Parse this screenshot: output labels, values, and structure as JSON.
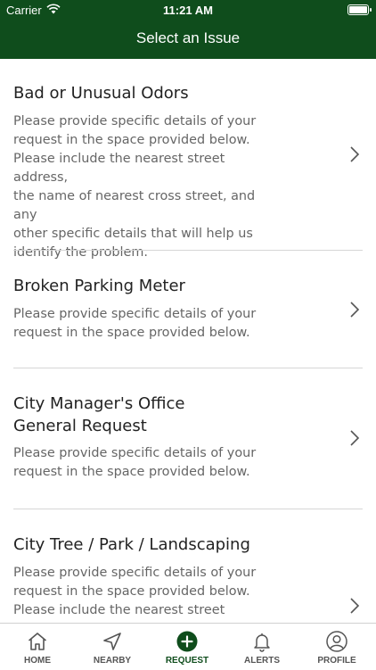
{
  "status": {
    "carrier": "Carrier",
    "time": "11:21 AM"
  },
  "nav": {
    "title": "Select an Issue"
  },
  "issues": [
    {
      "title": "Bad or Unusual Odors",
      "desc": "Please provide specific details of your\nrequest in the space provided below.\nPlease include the nearest street address,\nthe name of nearest cross street, and any\nother specific details that will help us\nidentify the problem."
    },
    {
      "title": "Broken Parking Meter",
      "desc": "Please provide specific details of your\nrequest in the space provided below."
    },
    {
      "title": "City Manager's Office\nGeneral Request",
      "desc": "Please provide specific details of your\nrequest in the space provided below."
    },
    {
      "title": "City Tree / Park / Landscaping",
      "desc": "Please provide specific details of your\nrequest in the space provided below.\nPlease include the nearest street address,"
    }
  ],
  "tabs": [
    {
      "label": "HOME",
      "icon": "home-icon"
    },
    {
      "label": "NEARBY",
      "icon": "navigation-arrow-icon"
    },
    {
      "label": "REQUEST",
      "icon": "plus-circle-icon",
      "active": true
    },
    {
      "label": "ALERTS",
      "icon": "bell-icon"
    },
    {
      "label": "PROFILE",
      "icon": "user-circle-icon"
    }
  ],
  "colors": {
    "brand": "#0f4d1c",
    "divider": "#d6d6d6",
    "title_text": "#222222",
    "desc_text": "#666666"
  }
}
